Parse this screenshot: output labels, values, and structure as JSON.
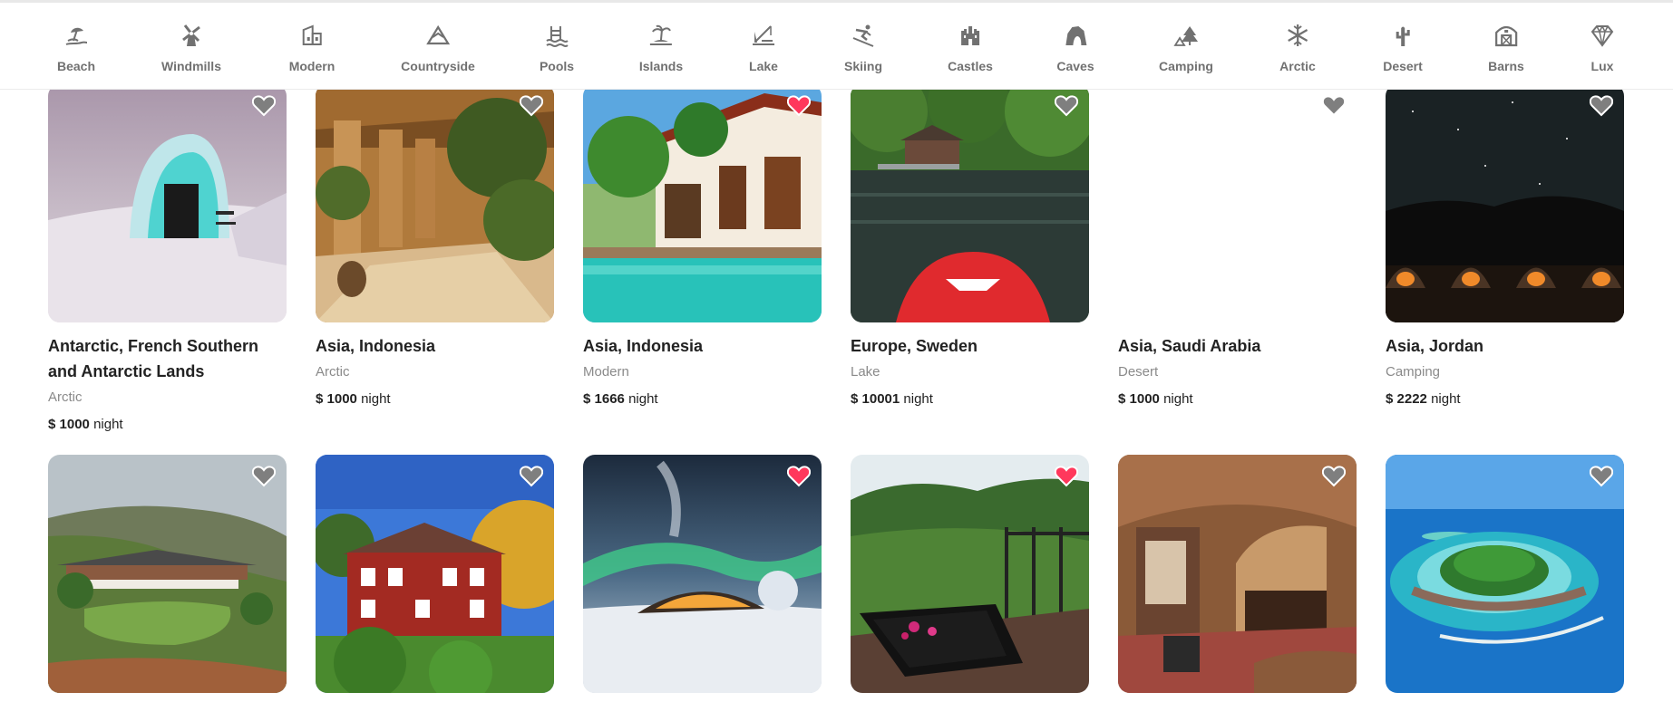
{
  "categories": [
    {
      "label": "Beach",
      "icon": "beach-icon"
    },
    {
      "label": "Windmills",
      "icon": "windmill-icon"
    },
    {
      "label": "Modern",
      "icon": "modern-icon"
    },
    {
      "label": "Countryside",
      "icon": "mountain-icon"
    },
    {
      "label": "Pools",
      "icon": "pool-icon"
    },
    {
      "label": "Islands",
      "icon": "island-icon"
    },
    {
      "label": "Lake",
      "icon": "lake-icon"
    },
    {
      "label": "Skiing",
      "icon": "skiing-icon"
    },
    {
      "label": "Castles",
      "icon": "castle-icon"
    },
    {
      "label": "Caves",
      "icon": "cave-icon"
    },
    {
      "label": "Camping",
      "icon": "camping-icon"
    },
    {
      "label": "Arctic",
      "icon": "snowflake-icon"
    },
    {
      "label": "Desert",
      "icon": "cactus-icon"
    },
    {
      "label": "Barns",
      "icon": "barn-icon"
    },
    {
      "label": "Lux",
      "icon": "diamond-icon"
    }
  ],
  "listings": [
    {
      "location": "Antarctic, French Southern and Antarctic Lands",
      "category": "Arctic",
      "price_label": "$ 1000",
      "unit": "night",
      "favorited": false
    },
    {
      "location": "Asia, Indonesia",
      "category": "Arctic",
      "price_label": "$ 1000",
      "unit": "night",
      "favorited": false
    },
    {
      "location": "Asia, Indonesia",
      "category": "Modern",
      "price_label": "$ 1666",
      "unit": "night",
      "favorited": true
    },
    {
      "location": "Europe, Sweden",
      "category": "Lake",
      "price_label": "$ 10001",
      "unit": "night",
      "favorited": false
    },
    {
      "location": "Asia, Saudi Arabia",
      "category": "Desert",
      "price_label": "$ 1000",
      "unit": "night",
      "favorited": false
    },
    {
      "location": "Asia, Jordan",
      "category": "Camping",
      "price_label": "$ 2222",
      "unit": "night",
      "favorited": false
    },
    {
      "favorited": false
    },
    {
      "favorited": false
    },
    {
      "favorited": true
    },
    {
      "favorited": true
    },
    {
      "favorited": false
    },
    {
      "favorited": false
    }
  ],
  "colors": {
    "heart_active": "#ff385c",
    "heart_inactive": "#7f7f7f",
    "category_text": "#717171"
  }
}
